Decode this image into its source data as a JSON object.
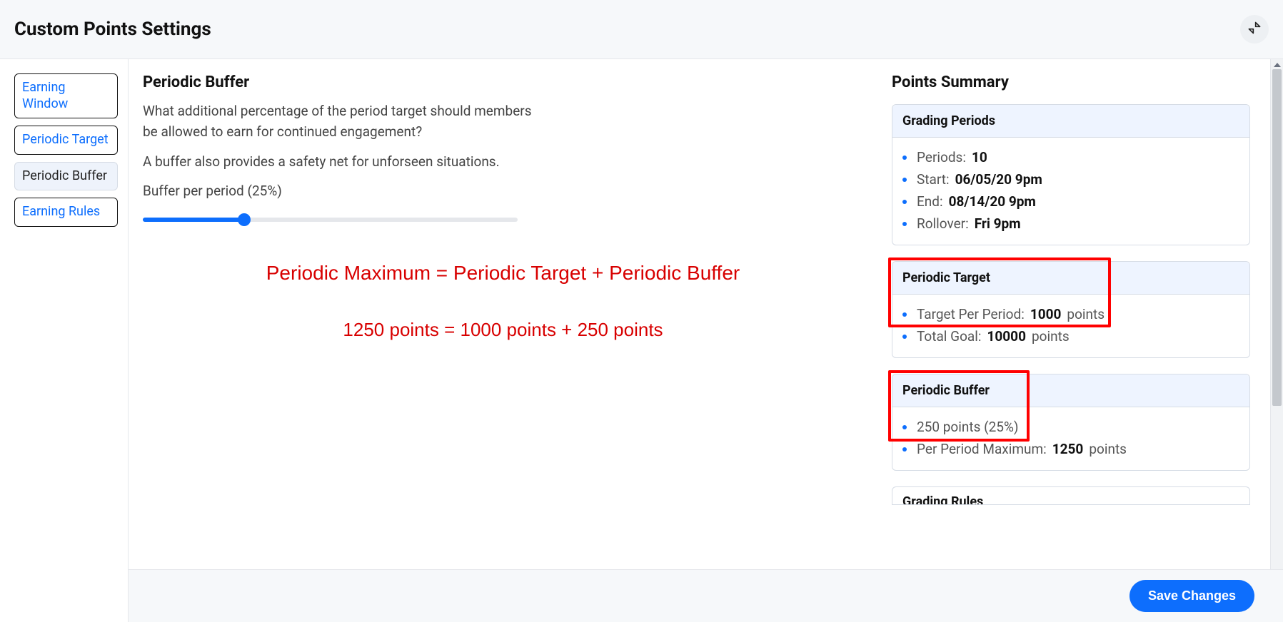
{
  "header": {
    "title": "Custom Points Settings"
  },
  "sidebar": {
    "items": [
      {
        "label": "Earning Window",
        "active": false
      },
      {
        "label": "Periodic Target",
        "active": false
      },
      {
        "label": "Periodic Buffer",
        "active": true
      },
      {
        "label": "Earning Rules",
        "active": false
      }
    ]
  },
  "buffer": {
    "heading": "Periodic Buffer",
    "desc1": "What additional percentage of the period target should members be allowed to earn for continued engagement?",
    "desc2": "A buffer also provides a safety net for unforseen situations.",
    "slider_label": "Buffer per period (25%)",
    "slider_percent": 27
  },
  "annotation": {
    "line1": "Periodic Maximum = Periodic Target + Periodic Buffer",
    "line2": "1250 points = 1000 points + 250 points"
  },
  "summary": {
    "heading": "Points Summary",
    "grading_periods": {
      "title": "Grading Periods",
      "periods_label": "Periods:",
      "periods_value": "10",
      "start_label": "Start:",
      "start_value": "06/05/20 9pm",
      "end_label": "End:",
      "end_value": "08/14/20 9pm",
      "rollover_label": "Rollover:",
      "rollover_value": "Fri 9pm"
    },
    "periodic_target": {
      "title": "Periodic Target",
      "target_label": "Target Per Period:",
      "target_value": "1000",
      "target_unit": "points",
      "goal_label": "Total Goal:",
      "goal_value": "10000",
      "goal_unit": "points"
    },
    "periodic_buffer": {
      "title": "Periodic Buffer",
      "buffer_text": "250 points (25%)",
      "max_label": "Per Period Maximum:",
      "max_value": "1250",
      "max_unit": "points"
    },
    "grading_rules": {
      "title_partial": "Grading Rules"
    }
  },
  "footer": {
    "save_label": "Save Changes"
  }
}
